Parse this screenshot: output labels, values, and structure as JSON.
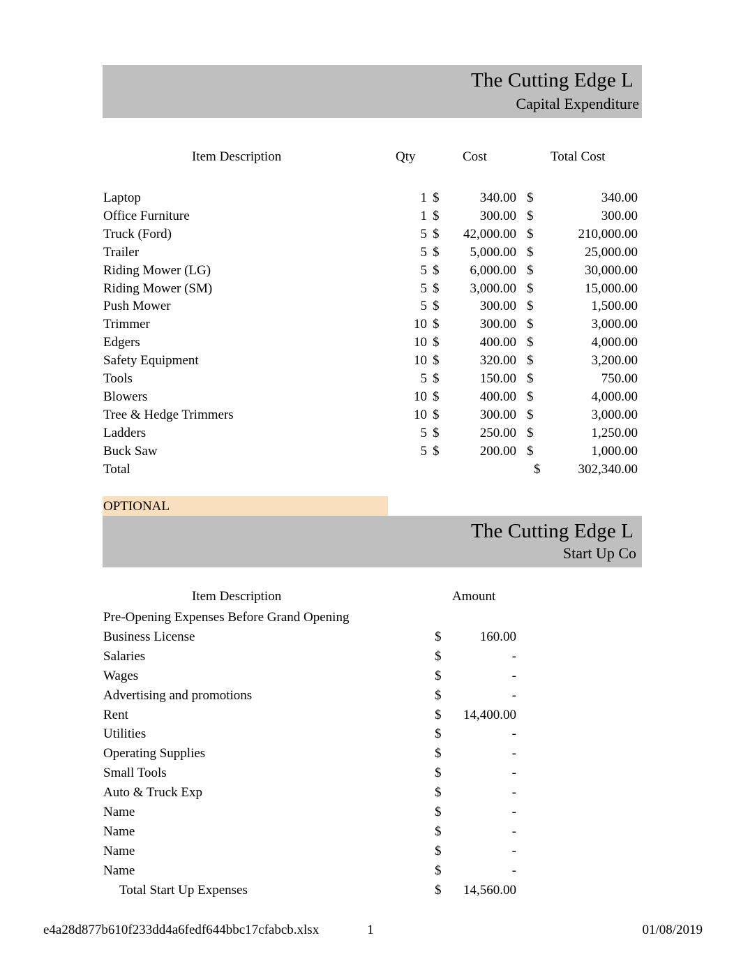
{
  "document": {
    "company_name": "The Cutting Edge L",
    "colors": {
      "banner_gray": "#BFBFBF",
      "optional_peach": "#FADFBE"
    }
  },
  "capital_expenditure": {
    "title": "The Cutting Edge L",
    "subtitle": "Capital Expenditure",
    "headers": {
      "item": "Item Description",
      "qty": "Qty",
      "cost": "Cost",
      "total_cost": "Total Cost"
    },
    "currency_symbol": "$",
    "rows": [
      {
        "item": "Laptop",
        "qty": "1",
        "cost": "340.00",
        "total": "340.00"
      },
      {
        "item": "Office Furniture",
        "qty": "1",
        "cost": "300.00",
        "total": "300.00"
      },
      {
        "item": "Truck (Ford)",
        "qty": "5",
        "cost": "42,000.00",
        "total": "210,000.00"
      },
      {
        "item": "Trailer",
        "qty": "5",
        "cost": "5,000.00",
        "total": "25,000.00"
      },
      {
        "item": "Riding Mower (LG)",
        "qty": "5",
        "cost": "6,000.00",
        "total": "30,000.00"
      },
      {
        "item": "Riding Mower (SM)",
        "qty": "5",
        "cost": "3,000.00",
        "total": "15,000.00"
      },
      {
        "item": "Push Mower",
        "qty": "5",
        "cost": "300.00",
        "total": "1,500.00"
      },
      {
        "item": "Trimmer",
        "qty": "10",
        "cost": "300.00",
        "total": "3,000.00"
      },
      {
        "item": "Edgers",
        "qty": "10",
        "cost": "400.00",
        "total": "4,000.00"
      },
      {
        "item": "Safety Equipment",
        "qty": "10",
        "cost": "320.00",
        "total": "3,200.00"
      },
      {
        "item": "Tools",
        "qty": "5",
        "cost": "150.00",
        "total": "750.00"
      },
      {
        "item": "Blowers",
        "qty": "10",
        "cost": "400.00",
        "total": "4,000.00"
      },
      {
        "item": "Tree & Hedge Trimmers",
        "qty": "10",
        "cost": "300.00",
        "total": "3,000.00"
      },
      {
        "item": "Ladders",
        "qty": "5",
        "cost": "250.00",
        "total": "1,250.00"
      },
      {
        "item": "Buck Saw",
        "qty": "5",
        "cost": "200.00",
        "total": "1,000.00"
      }
    ],
    "total_row": {
      "label": "Total",
      "currency_symbol": "$",
      "value": "302,340.00"
    }
  },
  "optional_banner": {
    "label": "OPTIONAL"
  },
  "start_up_costs": {
    "title": "The Cutting Edge L",
    "subtitle": "Start Up Co",
    "headers": {
      "item": "Item Description",
      "amount": "Amount"
    },
    "section_label": "Pre-Opening Expenses Before Grand Opening",
    "currency_symbol": "$",
    "rows": [
      {
        "item": "Business License",
        "amount": "160.00"
      },
      {
        "item": "Salaries",
        "amount": "-"
      },
      {
        "item": "Wages",
        "amount": "-"
      },
      {
        "item": "Advertising and promotions",
        "amount": "-"
      },
      {
        "item": "Rent",
        "amount": "14,400.00"
      },
      {
        "item": "Utilities",
        "amount": "-"
      },
      {
        "item": "Operating Supplies",
        "amount": "-"
      },
      {
        "item": "Small Tools",
        "amount": "-"
      },
      {
        "item": "Auto & Truck Exp",
        "amount": "-"
      },
      {
        "item": "Name",
        "amount": "-"
      },
      {
        "item": "Name",
        "amount": "-"
      },
      {
        "item": "Name",
        "amount": "-"
      },
      {
        "item": "Name",
        "amount": "-"
      }
    ],
    "total_row": {
      "label": "Total Start Up Expenses",
      "currency_symbol": "$",
      "value": "14,560.00"
    }
  },
  "footer": {
    "file_name": "e4a28d877b610f233dd4a6fedf644bbc17cfabcb.xlsx",
    "page_number": "1",
    "date": "01/08/2019"
  }
}
